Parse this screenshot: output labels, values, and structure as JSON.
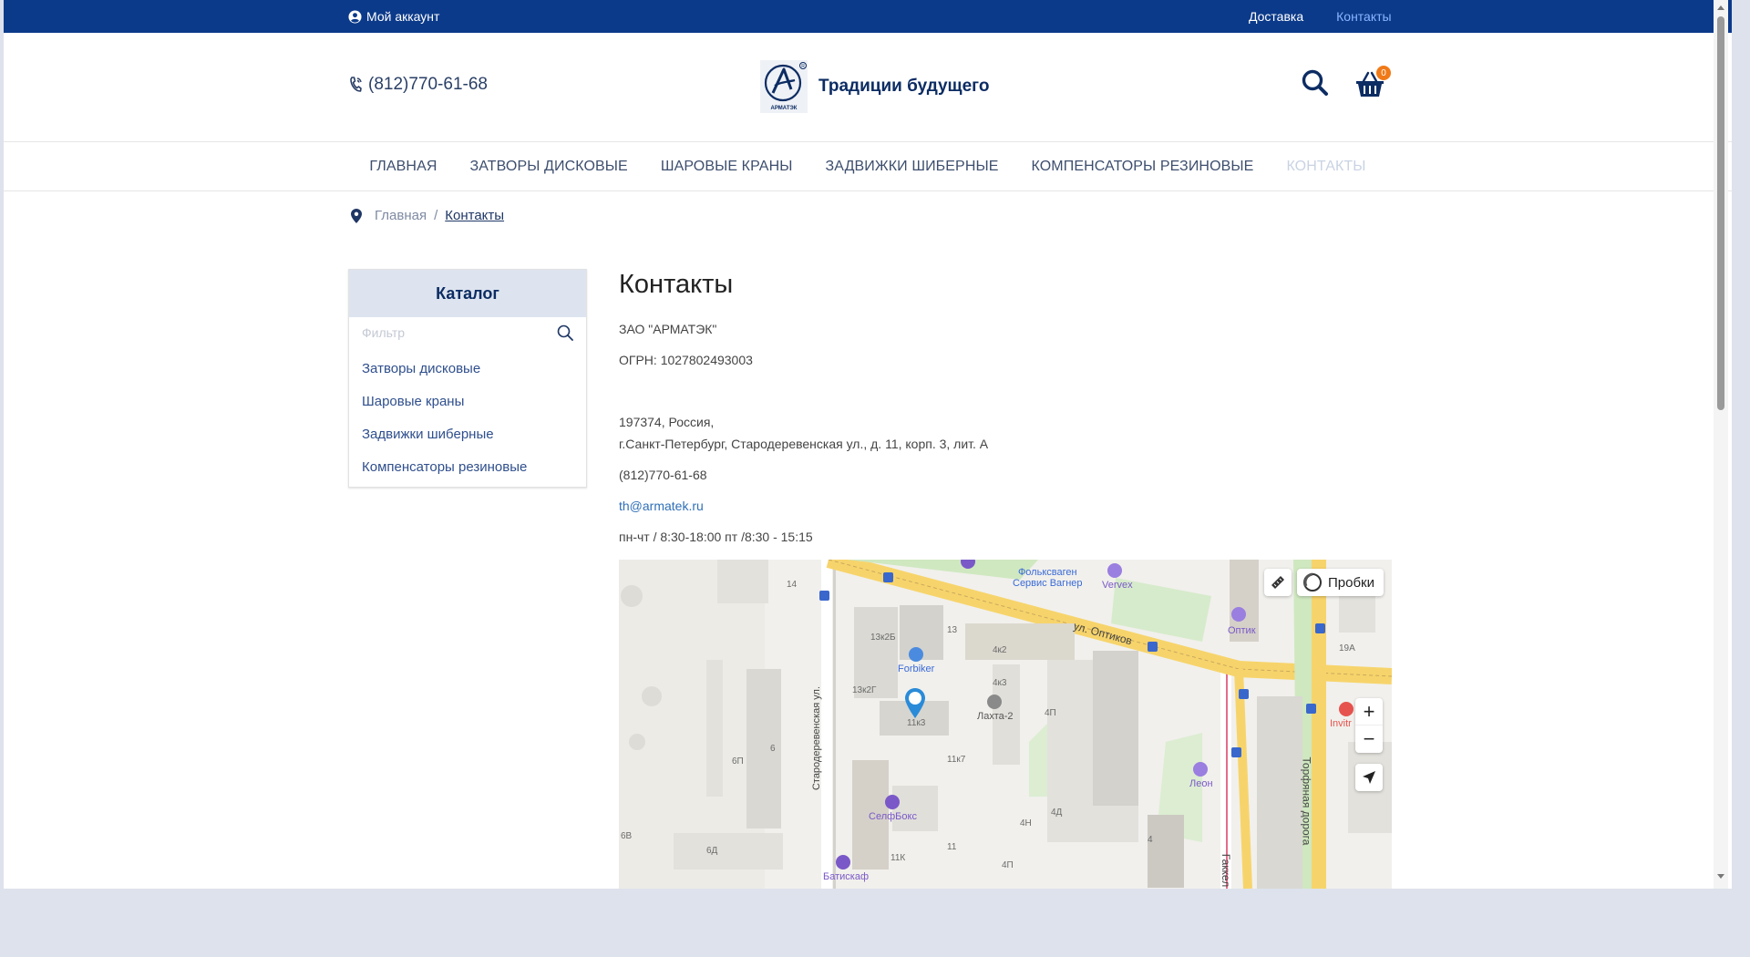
{
  "topbar": {
    "account_label": "Мой аккаунт",
    "links": [
      "Доставка",
      "Контакты"
    ]
  },
  "header": {
    "phone": "(812)770-61-68",
    "logo_brand": "АРМАТЭК",
    "slogan": "Традиции будущего",
    "cart_count": "0"
  },
  "nav": {
    "items": [
      "ГЛАВНАЯ",
      "ЗАТВОРЫ ДИСКОВЫЕ",
      "ШАРОВЫЕ КРАНЫ",
      "ЗАДВИЖКИ ШИБЕРНЫЕ",
      "КОМПЕНСАТОРЫ РЕЗИНОВЫЕ",
      "КОНТАКТЫ"
    ],
    "active": "КОНТАКТЫ"
  },
  "breadcrumb": {
    "home": "Главная",
    "separator": "/",
    "current": "Контакты"
  },
  "catalog": {
    "title": "Каталог",
    "filter_placeholder": "Фильтр",
    "items": [
      "Затворы дисковые",
      "Шаровые краны",
      "Задвижки шиберные",
      "Компенсаторы резиновые"
    ]
  },
  "contacts": {
    "title": "Контакты",
    "company": "ЗАО \"АРМАТЭК\"",
    "ogrn": "ОГРН: 1027802493003",
    "address_line1": "197374, Россия,",
    "address_line2": "г.Санкт-Петербург, Стародеревенская ул., д. 11, корп. 3, лит. А",
    "phone": "(812)770-61-68",
    "email": "th@armatek.ru",
    "hours": "пн-чт / 8:30-18:00 пт /8:30 - 15:15"
  },
  "map": {
    "traffic_label": "Пробки",
    "zoom_in": "+",
    "zoom_out": "−",
    "labels": {
      "folkswagen": "Фольксваген\nСервис Вагнер",
      "vervex": "Vervex",
      "optikov": "ул. Оптиков",
      "optik": "Оптик",
      "forbiker": "Forbiker",
      "lakhta": "Лахта-2",
      "selfboks": "СелфБокс",
      "batiskaf": "Батискаф",
      "leon": "Леон",
      "invitro": "Invitr",
      "starod": "Стародеревенская ул.",
      "torf": "Торфяная дорога",
      "gakkel": "Гаккел"
    },
    "building_numbers": [
      "14",
      "13к2Б",
      "13",
      "4к2",
      "4к3",
      "13к2Г",
      "11к3",
      "4П",
      "6П",
      "6",
      "11к7",
      "4Н",
      "4Д",
      "4",
      "6В",
      "6Д",
      "11К",
      "11",
      "4П",
      "19А"
    ]
  },
  "colors": {
    "topbar": "#0b3a8a",
    "brand_dark": "#0c2c63",
    "link": "#2f4f8d",
    "badge": "#f07a18",
    "map_marker": "#2a8bd8"
  }
}
